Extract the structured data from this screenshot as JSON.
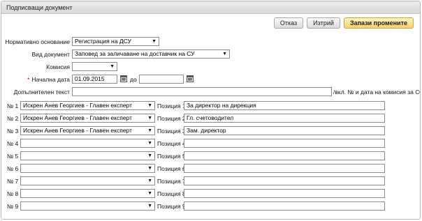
{
  "window": {
    "title": "Подписващи документ"
  },
  "toolbar": {
    "cancel_label": "Отказ",
    "delete_label": "Изтрий",
    "save_label": "Запази промените"
  },
  "form": {
    "basis": {
      "label": "Нормативно основание",
      "value": "Регистрация на ДСУ"
    },
    "doc_type": {
      "label": "Вид документ",
      "value": "Заповед за заличаване на доставчик на СУ"
    },
    "commission": {
      "label": "Комисия",
      "value": ""
    },
    "start_date": {
      "label": "Начална дата",
      "value": "01.09.2015",
      "to_label": "до",
      "to_value": ""
    },
    "extra_text": {
      "label": "Допълнителен текст",
      "value": "",
      "note": "/вкл. № и дата на комисия за СО/"
    }
  },
  "signers": [
    {
      "num": "№ 1",
      "person": "Искрен Анев Георгиев - Главен експерт",
      "pos_label": "Позиция 1",
      "position": "За директор на дирекция"
    },
    {
      "num": "№ 2",
      "person": "Искрен Анев Георгиев - Главен експерт",
      "pos_label": "Позиция 2",
      "position": "Гл. счетоводител"
    },
    {
      "num": "№ 3",
      "person": "Искрен Анев Георгиев - Главен експерт",
      "pos_label": "Позиция 3",
      "position": "Зам. директор"
    },
    {
      "num": "№ 4",
      "person": "",
      "pos_label": "Позиция 4",
      "position": ""
    },
    {
      "num": "№ 5",
      "person": "",
      "pos_label": "Позиция 5",
      "position": ""
    },
    {
      "num": "№ 6",
      "person": "",
      "pos_label": "Позиция 6",
      "position": ""
    },
    {
      "num": "№ 7",
      "person": "",
      "pos_label": "Позиция 7",
      "position": ""
    },
    {
      "num": "№ 8",
      "person": "",
      "pos_label": "Позиция 8",
      "position": ""
    },
    {
      "num": "№ 9",
      "person": "",
      "pos_label": "Позиция 9",
      "position": ""
    }
  ]
}
